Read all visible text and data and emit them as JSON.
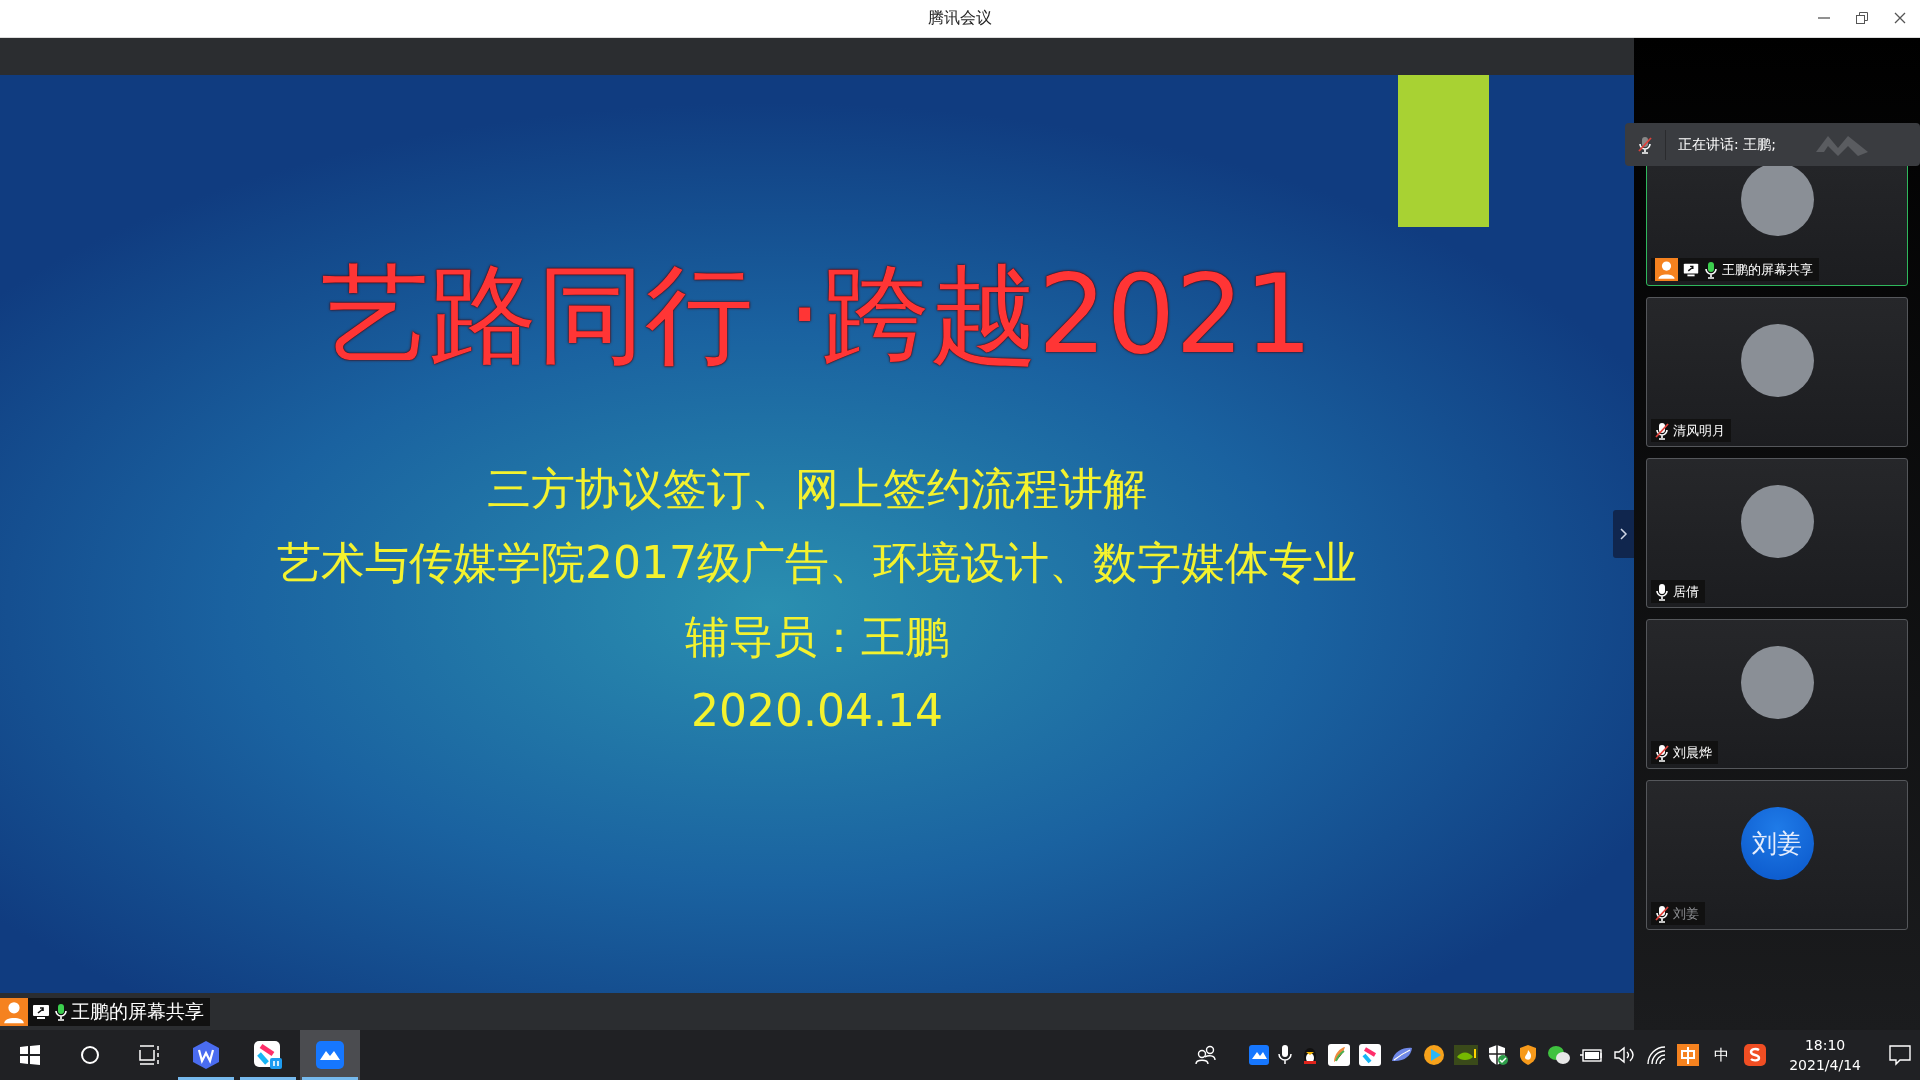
{
  "window": {
    "title": "腾讯会议"
  },
  "slide": {
    "title": "艺路同行 ·跨越2021",
    "lines": [
      "三方协议签订、网上签约流程讲解",
      "艺术与传媒学院2017级广告、环境设计、数字媒体专业",
      "辅导员：王鹏",
      "2020.04.14"
    ]
  },
  "share_label": {
    "text": "王鹏的屏幕共享",
    "host": true,
    "sharing": true,
    "speaking": true
  },
  "speaking_bar": {
    "text": "正在讲话: 王鹏;"
  },
  "participants": [
    {
      "name": "王鹏的屏幕共享",
      "kind": "photo",
      "host": true,
      "sharing": true,
      "speaking": true,
      "muted": false,
      "disabled": false
    },
    {
      "name": "清风明月",
      "kind": "photo",
      "host": false,
      "sharing": false,
      "speaking": false,
      "muted": true,
      "disabled": false
    },
    {
      "name": "居倩",
      "kind": "photo",
      "host": false,
      "sharing": false,
      "speaking": false,
      "muted": false,
      "disabled": false
    },
    {
      "name": "刘晨烨",
      "kind": "photo",
      "host": false,
      "sharing": false,
      "speaking": false,
      "muted": true,
      "disabled": false
    },
    {
      "name": "刘姜",
      "kind": "initials",
      "initials": "刘姜",
      "host": false,
      "sharing": false,
      "speaking": false,
      "muted": true,
      "disabled": true
    }
  ],
  "taskbar": {
    "apps": [
      {
        "kind": "wps",
        "open": true,
        "selected": false
      },
      {
        "kind": "youku",
        "open": true,
        "selected": false
      },
      {
        "kind": "meeting",
        "open": true,
        "selected": true
      }
    ],
    "ime": "中",
    "time": "18:10",
    "date": "2021/4/14"
  }
}
